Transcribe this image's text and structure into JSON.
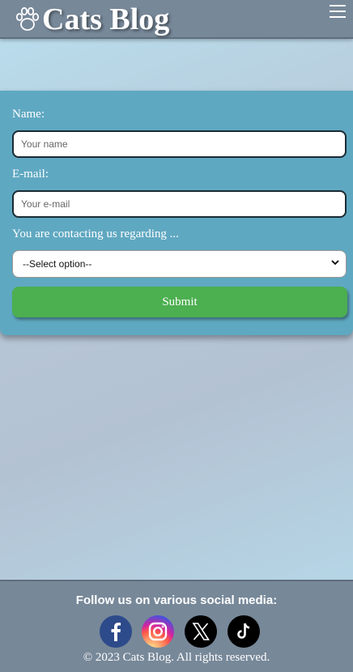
{
  "header": {
    "site_title": "Cats Blog",
    "logo_icon": "paw-icon",
    "menu_icon": "hamburger-icon"
  },
  "form": {
    "name_label": "Name:",
    "name_placeholder": "Your name",
    "email_label": "E-mail:",
    "email_placeholder": "Your e-mail",
    "regarding_label": "You are contacting us regarding ...",
    "select_value": "--Select option--",
    "submit_label": "Submit"
  },
  "footer": {
    "follow_text": "Follow us on various social media:",
    "socials": [
      "facebook-icon",
      "instagram-icon",
      "x-icon",
      "tiktok-icon"
    ],
    "copyright": "© 2023 Cats Blog. All rights reserved."
  },
  "colors": {
    "header": "#778899",
    "form": "#5fa8c1",
    "submit": "#4caf50"
  }
}
